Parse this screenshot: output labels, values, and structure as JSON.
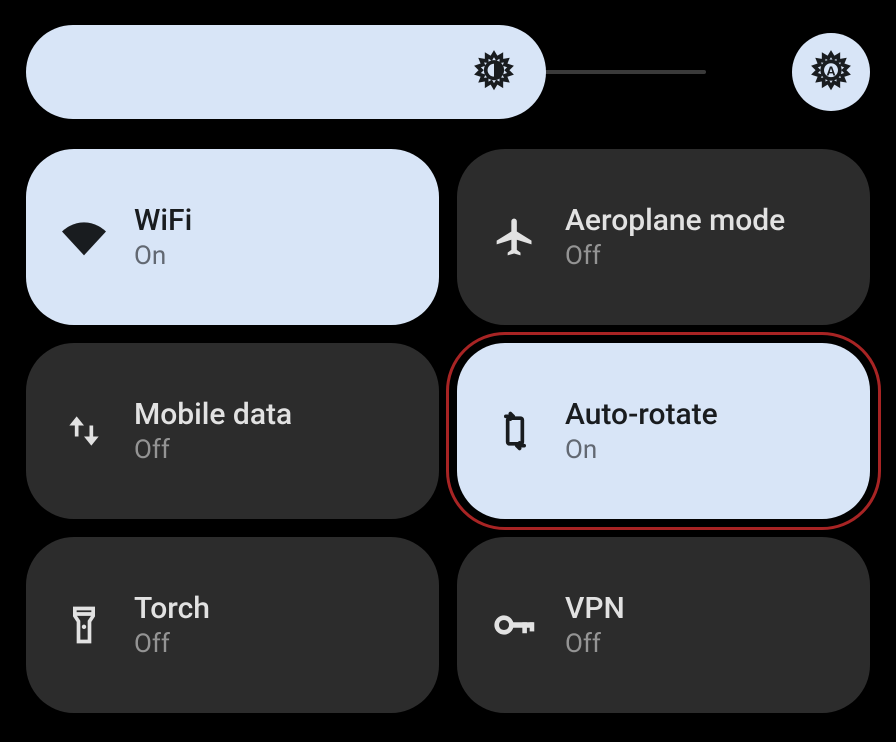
{
  "brightness": {
    "value_percent": 75,
    "auto_brightness_on": true
  },
  "status_text": {
    "on": "On",
    "off": "Off"
  },
  "tiles": [
    {
      "id": "wifi",
      "label": "WiFi",
      "status": "On",
      "state": "on",
      "icon": "wifi-icon"
    },
    {
      "id": "airplane",
      "label": "Aeroplane mode",
      "status": "Off",
      "state": "off",
      "icon": "airplane-icon"
    },
    {
      "id": "mobile",
      "label": "Mobile data",
      "status": "Off",
      "state": "off",
      "icon": "mobile-data-icon"
    },
    {
      "id": "rotate",
      "label": "Auto-rotate",
      "status": "On",
      "state": "on",
      "icon": "auto-rotate-icon",
      "highlighted": true
    },
    {
      "id": "torch",
      "label": "Torch",
      "status": "Off",
      "state": "off",
      "icon": "torch-icon"
    },
    {
      "id": "vpn",
      "label": "VPN",
      "status": "Off",
      "state": "off",
      "icon": "vpn-icon"
    }
  ],
  "colors": {
    "tile_on_bg": "#d8e5f7",
    "tile_off_bg": "#2c2c2c",
    "highlight_outline": "#a82424"
  }
}
